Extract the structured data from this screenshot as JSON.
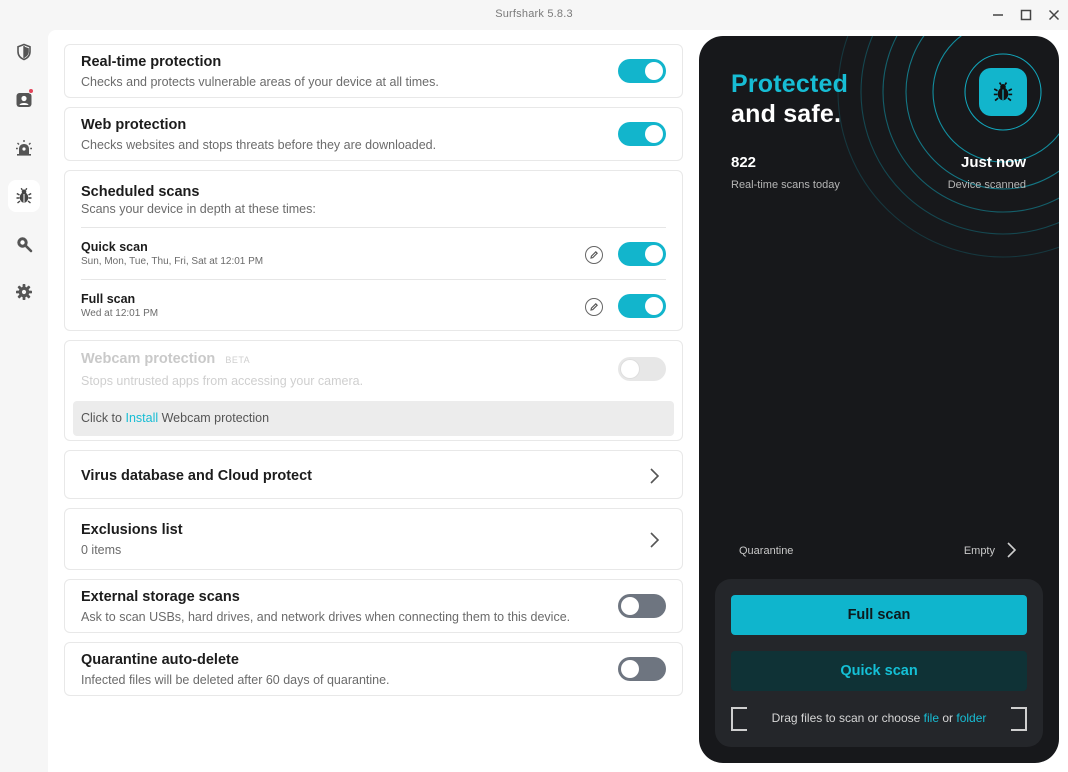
{
  "window": {
    "title": "Surfshark 5.8.3"
  },
  "nav": {
    "items": [
      {
        "name": "vpn",
        "icon": "shield-icon"
      },
      {
        "name": "alert",
        "icon": "user-alert-icon",
        "badge": true
      },
      {
        "name": "alternative-id",
        "icon": "sun-bug-icon"
      },
      {
        "name": "antivirus",
        "icon": "bug-icon",
        "active": true
      },
      {
        "name": "search",
        "icon": "search-icon"
      },
      {
        "name": "settings",
        "icon": "gear-icon"
      }
    ]
  },
  "settings": {
    "realtime": {
      "title": "Real-time protection",
      "subtitle": "Checks and protects vulnerable areas of your device at all times.",
      "enabled": true
    },
    "web": {
      "title": "Web protection",
      "subtitle": "Checks websites and stops threats before they are downloaded.",
      "enabled": true
    },
    "scheduled": {
      "title": "Scheduled scans",
      "subtitle": "Scans your device in depth at these times:",
      "rows": [
        {
          "title": "Quick scan",
          "schedule": "Sun, Mon, Tue, Thu, Fri, Sat at 12:01 PM",
          "enabled": true
        },
        {
          "title": "Full scan",
          "schedule": "Wed at 12:01 PM",
          "enabled": true
        }
      ]
    },
    "webcam": {
      "title": "Webcam protection",
      "badge": "BETA",
      "subtitle": "Stops untrusted apps from accessing your camera.",
      "enabled": false,
      "install_prefix": "Click to",
      "install_link": "Install",
      "install_suffix": "Webcam protection"
    },
    "virusdb": {
      "title": "Virus database and Cloud protect"
    },
    "exclusions": {
      "title": "Exclusions list",
      "subtitle": "0 items"
    },
    "external": {
      "title": "External storage scans",
      "subtitle": "Ask to scan USBs, hard drives, and network drives when connecting them to this device.",
      "enabled": false
    },
    "quarantine_delete": {
      "title": "Quarantine auto-delete",
      "subtitle": "Infected files will be deleted after 60 days of quarantine.",
      "enabled": false
    }
  },
  "status": {
    "headline_accent": "Protected",
    "headline": "and safe.",
    "scans_today": "822",
    "scans_today_label": "Real-time scans today",
    "last_scan": "Just now",
    "last_scan_label": "Device scanned",
    "quarantine_label": "Quarantine",
    "quarantine_value": "Empty",
    "full_scan_label": "Full scan",
    "quick_scan_label": "Quick scan",
    "drag_prefix": "Drag files to scan or choose",
    "drag_file": "file",
    "drag_or": "or",
    "drag_folder": "folder"
  },
  "colors": {
    "accent": "#12b5cc",
    "dark_panel": "#17181b",
    "toggle_off": "#6e7580"
  }
}
